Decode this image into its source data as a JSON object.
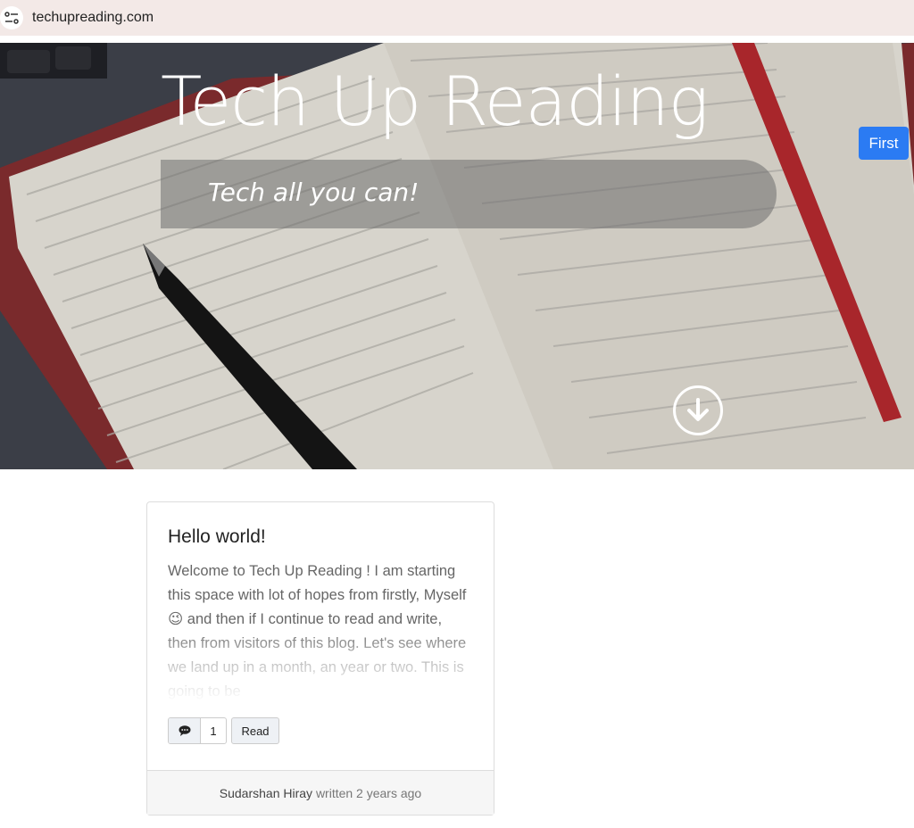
{
  "browser": {
    "url": "techupreading.com",
    "site_icon": "tune-icon"
  },
  "hero": {
    "title": "Tech Up Reading",
    "tagline": "Tech all you can!",
    "scroll_icon": "arrow-down-circle-icon"
  },
  "nav": {
    "first_label": "First"
  },
  "post": {
    "title": "Hello world!",
    "excerpt": "Welcome to Tech Up Reading ! I am starting this space with lot of hopes from firstly, Myself 😉 and then if I continue to read and write, then from visitors of this blog. Let's see where we land up in a month, an year or two. This is going to be",
    "comment_icon": "comment-icon",
    "comment_count": "1",
    "read_label": "Read",
    "author": "Sudarshan Hiray",
    "written_text": "written 2 years ago"
  },
  "colors": {
    "primary": "#2b7bf3",
    "urlbar": "#f3e9e7"
  }
}
